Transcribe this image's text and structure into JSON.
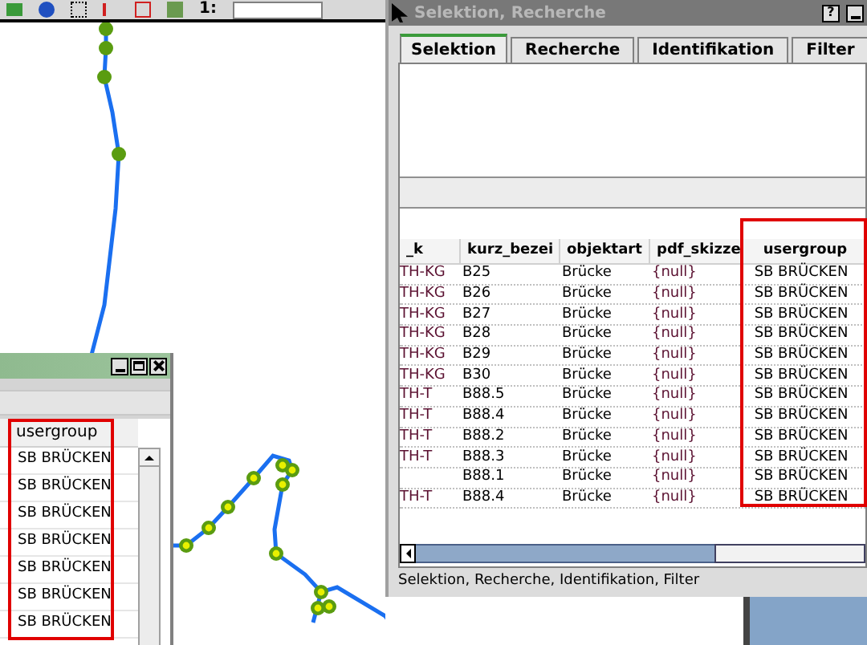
{
  "toolbar": {
    "scale_label": "1:"
  },
  "left_window": {
    "columns": [
      "usergroup"
    ],
    "rows": [
      [
        "SB BRÜCKEN"
      ],
      [
        "SB BRÜCKEN"
      ],
      [
        "SB BRÜCKEN"
      ],
      [
        "SB BRÜCKEN"
      ],
      [
        "SB BRÜCKEN"
      ],
      [
        "SB BRÜCKEN"
      ],
      [
        "SB BRÜCKEN"
      ]
    ]
  },
  "right_window": {
    "title": "Selektion, Recherche",
    "help_button": "?",
    "tabs": [
      {
        "label": "Selektion",
        "selected": true
      },
      {
        "label": "Recherche",
        "selected": false
      },
      {
        "label": "Identifikation",
        "selected": false
      },
      {
        "label": "Filter",
        "selected": false
      }
    ],
    "table": {
      "columns": [
        "_k",
        "kurz_bezei",
        "objektart",
        "pdf_skizze",
        "usergroup"
      ],
      "rows": [
        [
          "TH-KG",
          "B25",
          "Brücke",
          "{null}",
          "SB BRÜCKEN"
        ],
        [
          "TH-KG",
          "B26",
          "Brücke",
          "{null}",
          "SB BRÜCKEN"
        ],
        [
          "TH-KG",
          "B27",
          "Brücke",
          "{null}",
          "SB BRÜCKEN"
        ],
        [
          "TH-KG",
          "B28",
          "Brücke",
          "{null}",
          "SB BRÜCKEN"
        ],
        [
          "TH-KG",
          "B29",
          "Brücke",
          "{null}",
          "SB BRÜCKEN"
        ],
        [
          "TH-KG",
          "B30",
          "Brücke",
          "{null}",
          "SB BRÜCKEN"
        ],
        [
          "TH-T",
          "B88.5",
          "Brücke",
          "{null}",
          "SB BRÜCKEN"
        ],
        [
          "TH-T",
          "B88.4",
          "Brücke",
          "{null}",
          "SB BRÜCKEN"
        ],
        [
          "TH-T",
          "B88.2",
          "Brücke",
          "{null}",
          "SB BRÜCKEN"
        ],
        [
          "TH-T",
          "B88.3",
          "Brücke",
          "{null}",
          "SB BRÜCKEN"
        ],
        [
          "",
          "B88.1",
          "Brücke",
          "{null}",
          "SB BRÜCKEN"
        ],
        [
          "TH-T",
          "B88.4",
          "Brücke",
          "{null}",
          "SB BRÜCKEN"
        ]
      ]
    },
    "status": "Selektion, Recherche, Identifikation, Filter"
  }
}
